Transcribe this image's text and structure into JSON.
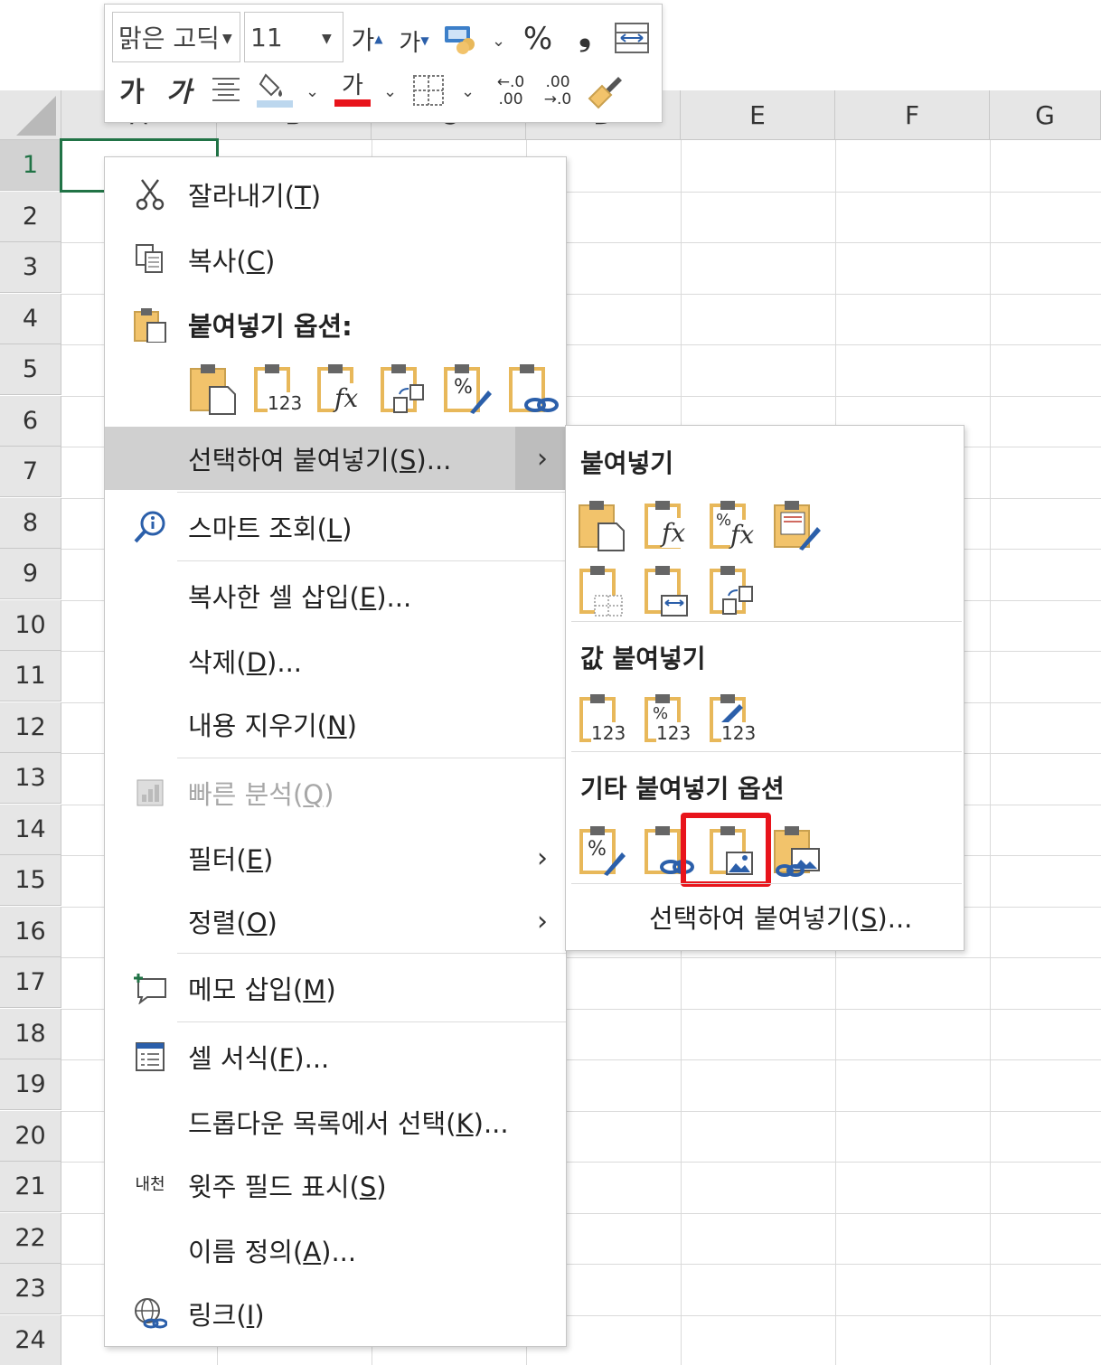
{
  "grid": {
    "columns": [
      "A",
      "B",
      "C",
      "D",
      "E",
      "F",
      "G"
    ],
    "rows": [
      "1",
      "2",
      "3",
      "4",
      "5",
      "6",
      "7",
      "8",
      "9",
      "10",
      "11",
      "12",
      "13",
      "14",
      "15",
      "16",
      "17",
      "18",
      "19",
      "20",
      "21",
      "22",
      "23",
      "24"
    ],
    "selected_cell": "A1"
  },
  "mini_toolbar": {
    "font_name": "맑은 고딕",
    "font_size": "11",
    "grow_font": "가",
    "shrink_font": "가",
    "percent": "%",
    "comma": "❟",
    "bold": "가",
    "italic": "가",
    "font_color_glyph": "가",
    "increase_decimal_top": "←.0",
    "increase_decimal_bottom": ".00",
    "decrease_decimal_top": ".00",
    "decrease_decimal_bottom": "→.0",
    "icons": [
      "accounting-format-icon",
      "merge-center-icon",
      "align-center-icon",
      "fill-color-icon",
      "font-color-icon",
      "borders-icon",
      "format-painter-icon"
    ]
  },
  "context_menu": {
    "cut": {
      "text": "잘라내기",
      "key": "T"
    },
    "copy": {
      "text": "복사",
      "key": "C"
    },
    "paste_options": "붙여넣기 옵션:",
    "paste_special": {
      "text": "선택하여 붙여넣기",
      "key": "S",
      "suffix": "..."
    },
    "smart_lookup": {
      "text": "스마트 조회",
      "key": "L"
    },
    "insert_copied": {
      "text": "복사한 셀 삽입",
      "key": "E",
      "suffix": "..."
    },
    "delete": {
      "text": "삭제",
      "key": "D",
      "suffix": "..."
    },
    "clear_contents": {
      "text": "내용 지우기",
      "key": "N"
    },
    "quick_analysis": {
      "text": "빠른 분석",
      "key": "Q"
    },
    "filter": {
      "text": "필터",
      "key": "E"
    },
    "sort": {
      "text": "정렬",
      "key": "O"
    },
    "insert_comment": {
      "text": "메모 삽입",
      "key": "M"
    },
    "format_cells": {
      "text": "셀 서식",
      "key": "F",
      "suffix": "..."
    },
    "pick_dropdown": {
      "text": "드롭다운 목록에서 선택",
      "key": "K",
      "suffix": "..."
    },
    "phonetic": {
      "text": "윗주 필드 표시",
      "key": "S"
    },
    "define_name": {
      "text": "이름 정의",
      "key": "A",
      "suffix": "..."
    },
    "link": {
      "text": "링크",
      "key": "I"
    },
    "phonetic_icon_text": "내천"
  },
  "submenu": {
    "paste_heading": "붙여넣기",
    "values_heading": "값 붙여넣기",
    "other_heading": "기타 붙여넣기 옵션",
    "paste_special": {
      "text": "선택하여 붙여넣기",
      "key": "S",
      "suffix": "..."
    },
    "icon_texts": {
      "fx": "fx",
      "pct": "%",
      "num": "123"
    }
  },
  "colors": {
    "accent_green": "#217346",
    "highlight_red": "#e8141b",
    "clipboard_gold": "#f2c36b"
  }
}
